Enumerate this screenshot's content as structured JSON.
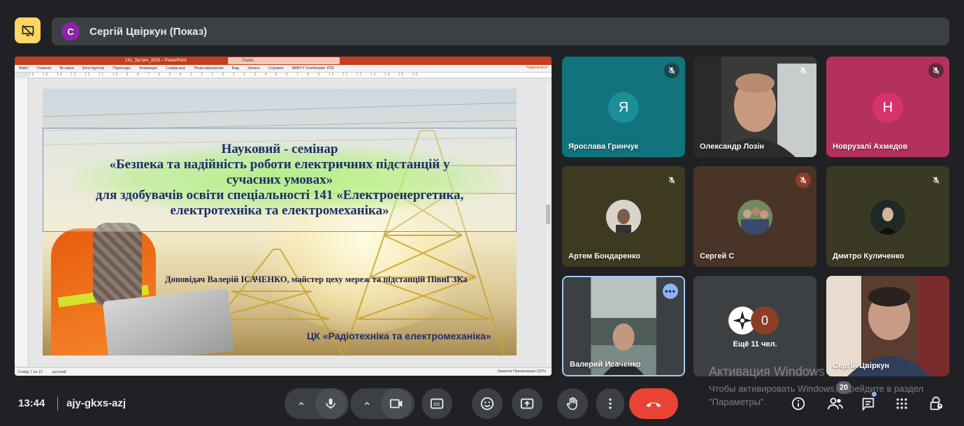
{
  "presenter": {
    "initial": "С",
    "name": "Сергій Цвіркун (Показ)",
    "avatar_color": "#8e24aa"
  },
  "ppt": {
    "title_text": "141_Зустріч_2025 – PowerPoint",
    "search_placeholder": "Поиск",
    "menu": [
      "Файл",
      "Главная",
      "Вставка",
      "Конструктор",
      "Переходы",
      "Анимация",
      "Слайд-шоу",
      "Рецензирование",
      "Вид",
      "Запись",
      "Справка",
      "ABBYY FineReader PDF"
    ],
    "share": "Поделиться",
    "status_left": "Слайд 7 из 12",
    "status_lang": "русский",
    "status_right": "Заметки   Примечания   115%"
  },
  "slide": {
    "line1": "Науковий - семінар",
    "line2": "«Безпека та надійність роботи електричних підстанцій у",
    "line3": "сучасних умовах»",
    "line4": "для здобувачів освіти спеціальності 141 «Електроенергетика,",
    "line5": "електротехніка та електромеханіка»",
    "speaker": "Доповідач Валерій ІСАЧЕНКО, майстер цеху мереж та підстанцій ПівнГЗКа",
    "department": "ЦК «Радіотехніка та електромеханіка»"
  },
  "participants": [
    {
      "name": "Ярослава Гринчук",
      "initial": "Я",
      "bg": "#12737c",
      "avatar": "#1a8f99"
    },
    {
      "name": "Олександр Лозін"
    },
    {
      "name": "Новрузалі Ахмедов",
      "initial": "Н",
      "bg": "#b4305f",
      "avatar": "#d6336c"
    },
    {
      "name": "Артем Бондаренко"
    },
    {
      "name": "Сергей С"
    },
    {
      "name": "Дмитро Куличенко"
    },
    {
      "name": "Валерий Исаченко"
    },
    {
      "others_count": "0",
      "others_label": "Ещё 11 чел."
    },
    {
      "name": "Сергій Цвіркун"
    }
  ],
  "watermark": {
    "title": "Активация Windows",
    "subtitle": "Чтобы активировать Windows, перейдите в раздел \"Параметры\"."
  },
  "footer": {
    "time": "13:44",
    "meeting_code": "ajy-gkxs-azj",
    "participant_count": "20"
  },
  "colors": {
    "background": "#202124",
    "bar": "#3c4043",
    "end_call": "#ea4335",
    "accent": "#8ab4f8",
    "present_toggle": "#fdd663"
  }
}
